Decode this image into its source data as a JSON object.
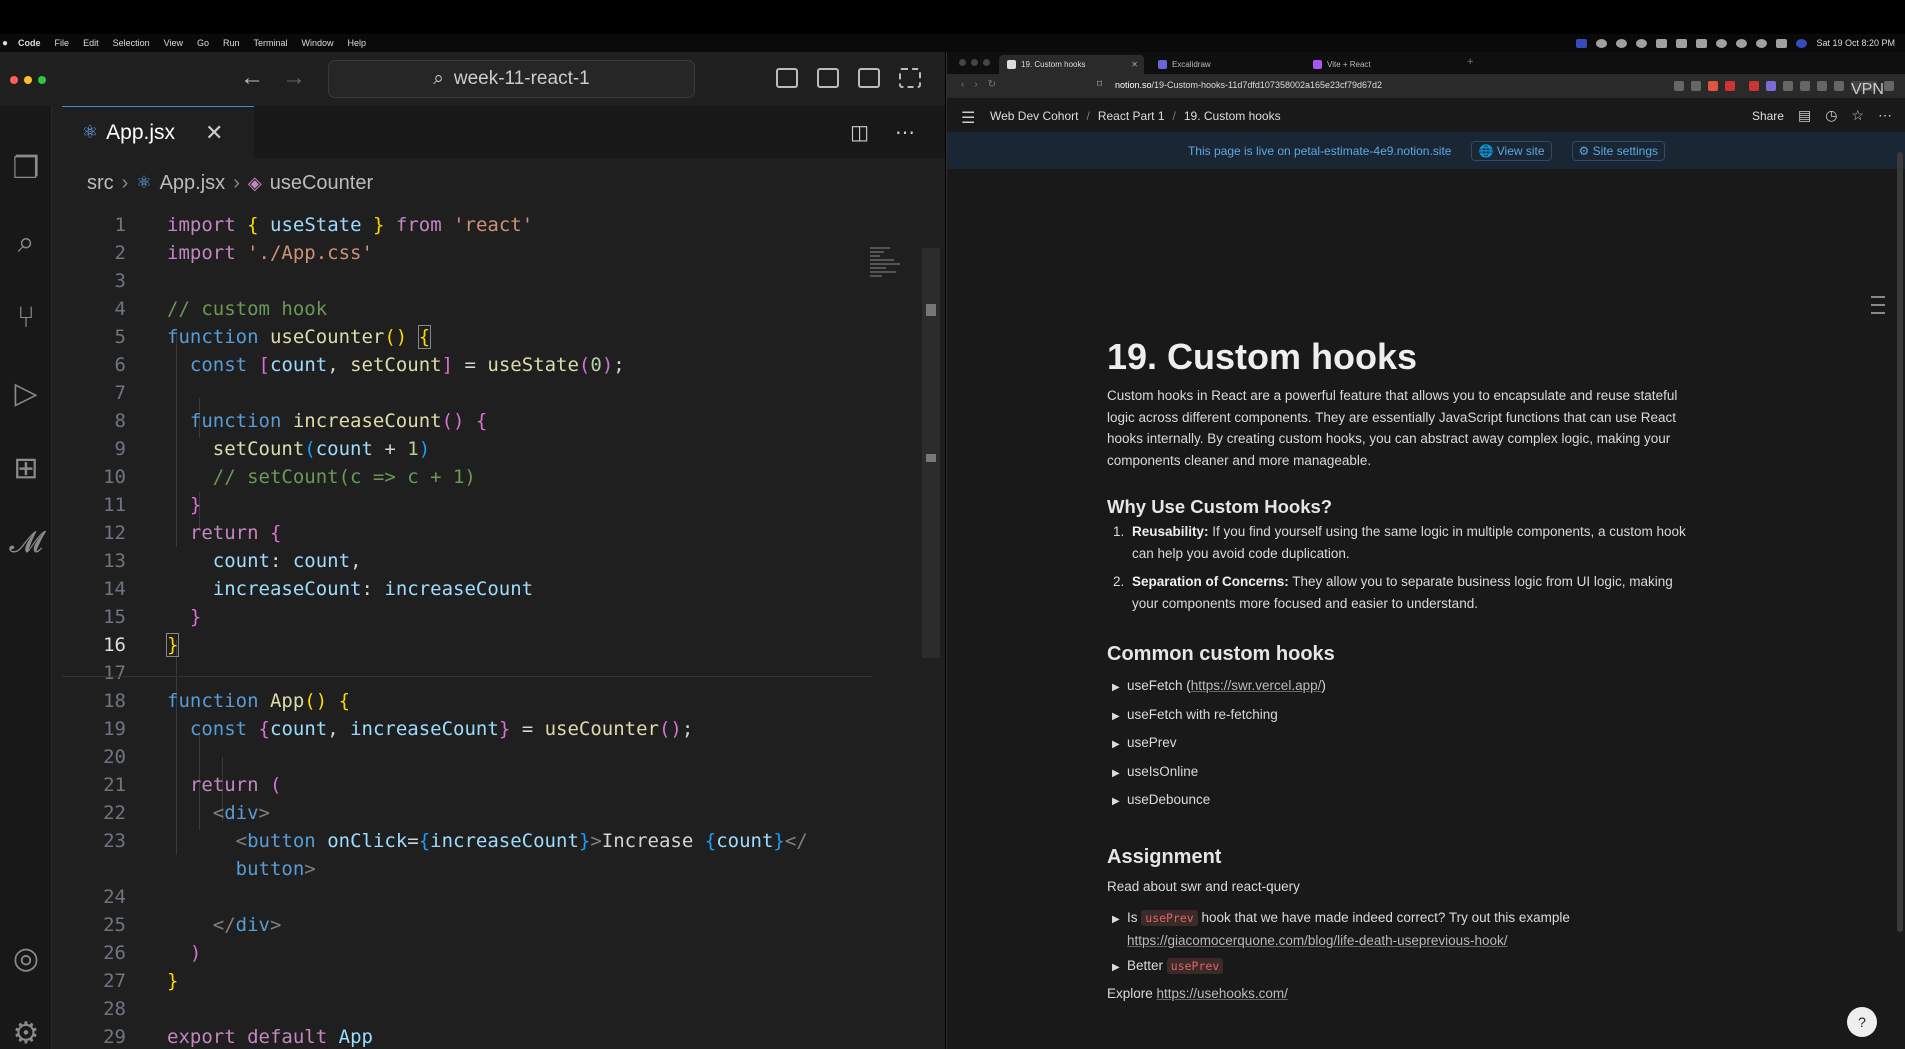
{
  "menubar": {
    "app": "Code",
    "items": [
      "File",
      "Edit",
      "Selection",
      "View",
      "Go",
      "Run",
      "Terminal",
      "Window",
      "Help"
    ],
    "clock": "Sat 19 Oct 8:20 PM",
    "vpn": "VPN"
  },
  "vscode": {
    "search": "week-11-react-1",
    "tab": {
      "label": "App.jsx",
      "close": "✕"
    },
    "breadcrumb": {
      "folder": "src",
      "file": "App.jsx",
      "symbol": "useCounter"
    },
    "line_numbers": [
      "1",
      "2",
      "3",
      "4",
      "5",
      "6",
      "7",
      "8",
      "9",
      "10",
      "11",
      "12",
      "13",
      "14",
      "15",
      "16",
      "17",
      "18",
      "19",
      "20",
      "21",
      "22",
      "23",
      "",
      "24",
      "25",
      "26",
      "27",
      "28",
      "29"
    ],
    "lines": [
      [
        "import",
        " ",
        "{",
        " useState ",
        "}",
        " from ",
        "'react'"
      ],
      [
        "import",
        " ",
        "'./App.css'"
      ]
    ]
  },
  "browser": {
    "tabs": [
      "19. Custom hooks",
      "Excalidraw",
      "Vite + React"
    ],
    "url_host": "notion.so",
    "url_path": "/19-Custom-hooks-11d7dfd107358002a165e23cf79d67d2",
    "breadcrumbs": [
      "Web Dev Cohort",
      "React Part 1",
      "19. Custom hooks"
    ],
    "share": "Share",
    "banner": {
      "message": "This page is live on petal-estimate-4e9.notion.site",
      "view_site": "View site",
      "site_settings": "Site settings"
    },
    "page": {
      "title": "19. Custom hooks",
      "intro_lines": [
        "Custom hooks in React are a powerful feature that allows you to encapsulate and reuse stateful",
        "logic across different components. They are essentially JavaScript functions that can use React",
        "hooks internally. By creating custom hooks, you can abstract away complex logic, making your",
        "components cleaner and more manageable."
      ],
      "why_heading": "Why Use Custom Hooks?",
      "why_items": [
        {
          "num": "1.",
          "bold": "Reusability:",
          "line1": " If you find yourself using the same logic in multiple components, a custom hook",
          "line2": "can help you avoid code duplication."
        },
        {
          "num": "2.",
          "bold": "Separation of Concerns:",
          "line1": " They allow you to separate business logic from UI logic, making",
          "line2": "your components more focused and easier to understand."
        }
      ],
      "common_heading": "Common custom hooks",
      "common_items": [
        {
          "label": "useFetch (",
          "link": "https://swr.vercel.app/",
          "tail": ")"
        },
        {
          "label": "useFetch with re-fetching"
        },
        {
          "label": "usePrev"
        },
        {
          "label": "useIsOnline"
        },
        {
          "label": "useDebounce"
        }
      ],
      "assignment_heading": "Assignment",
      "assignment_text": "Read about swr and react-query",
      "assignment_item1": {
        "pre": "Is ",
        "chip": "usePrev",
        "post": " hook that we have made indeed correct? Try out this example",
        "link": "https://giacomocerquone.com/blog/life-death-useprevious-hook/"
      },
      "assignment_item2": {
        "pre": "Better ",
        "chip": "usePrev"
      },
      "explore": {
        "pre": "Explore ",
        "link": "https://usehooks.com/"
      }
    }
  },
  "colors": {
    "accent": "#0a78d4",
    "notion_link": "#5aa9e6",
    "code_chip": "#e0655f"
  }
}
